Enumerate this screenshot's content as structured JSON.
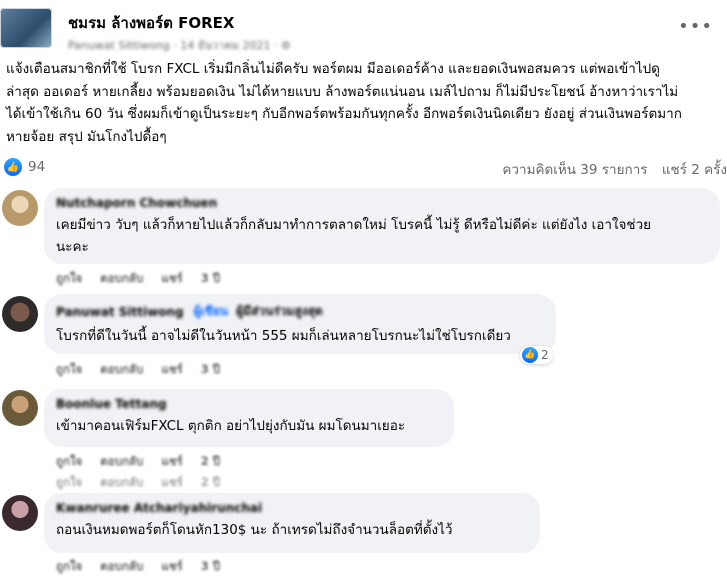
{
  "post": {
    "group_name": "ชมรม ล้างพอร์ต FOREX",
    "poster_meta": "Panuwat Sittiwong · 14 ธันวาคม 2021 · ⚙",
    "more_icon": "more-horizontal-icon",
    "text": "แจ้งเตือนสมาชิกที่ใช้ โบรก FXCL  เริ่มมีกลิ่นไม่ดีครับ พอร์ตผม มีออเดอร์ค้าง และยอดเงินพอสมควร แต่พอเข้าไปดู\nล่าสุด ออเดอร์ หายเกลี้ยง พร้อมยอดเงิน ไม่ได้หายแบบ ล้างพอร์ตแน่นอน เมล์ไปถาม ก็ไม่มีประโยชน์ อ้างหาว่าเราไม่\nได้เข้าใช้เกิน 60 วัน ซึ่งผมก็เข้าดูเป็นระยะๆ กับอีกพอร์ตพร้อมกันทุกครั้ง อีกพอร์ตเงินนิดเดียว ยังอยู่ ส่วนเงินพอร์ตมาก\nหายจ้อย สรุป มันโกงไปดื้อๆ",
    "reaction_count": "94",
    "comment_count": "ความคิดเห็น 39 รายการ",
    "share_count": "แชร์ 2 ครั้ง"
  },
  "comments": [
    {
      "name": "Nutchaporn Chowchuen",
      "text": "เคยมีข่าว วับๆ แล้วก็หายไปแล้วก็กลับมาทำการตลาดใหม่ โบรคนี้ ไม่รู้ ดีหรือไม่ดีค่ะ แต่ยังไง เอาใจช่วย\nนะคะ",
      "actions": [
        "ถูกใจ",
        "ตอบกลับ",
        "แชร์",
        "3 ปี"
      ]
    },
    {
      "name": "Panuwat Sittiwong",
      "badge": "ผู้เขียน",
      "badge2": "ผู้มีส่วนร่วมสูงสุด",
      "text": "โบรกที่ดีในวันนี้ อาจไม่ดีในวันหน้า 555 ผมก็เล่นหลายโบรกนะไม่ใช่โบรกเดียว",
      "likes": "2",
      "actions": [
        "ถูกใจ",
        "ตอบกลับ",
        "แชร์",
        "3 ปี"
      ]
    },
    {
      "name": "Boonlue Tettang",
      "text": "เข้ามาคอนเฟิร์มFXCL ตุกติก อย่าไปยุ่งกับมัน ผมโดนมาเยอะ",
      "actions": [
        "ถูกใจ",
        "ตอบกลับ",
        "แชร์",
        "2 ปี"
      ]
    },
    {
      "name": "Kwanruree Atchariyahirunchai",
      "text": "ถอนเงินหมดพอร์ตก็โดนหัก130$ นะ ถ้าเทรดไม่ถึงจำนวนล็อตที่ตั้งไว้",
      "actions": [
        "ถูกใจ",
        "ตอบกลับ",
        "แชร์",
        "3 ปี"
      ]
    }
  ],
  "colors": {
    "accent": "#0866ff",
    "bubble": "#f0f2f5",
    "muted": "#65676b"
  }
}
